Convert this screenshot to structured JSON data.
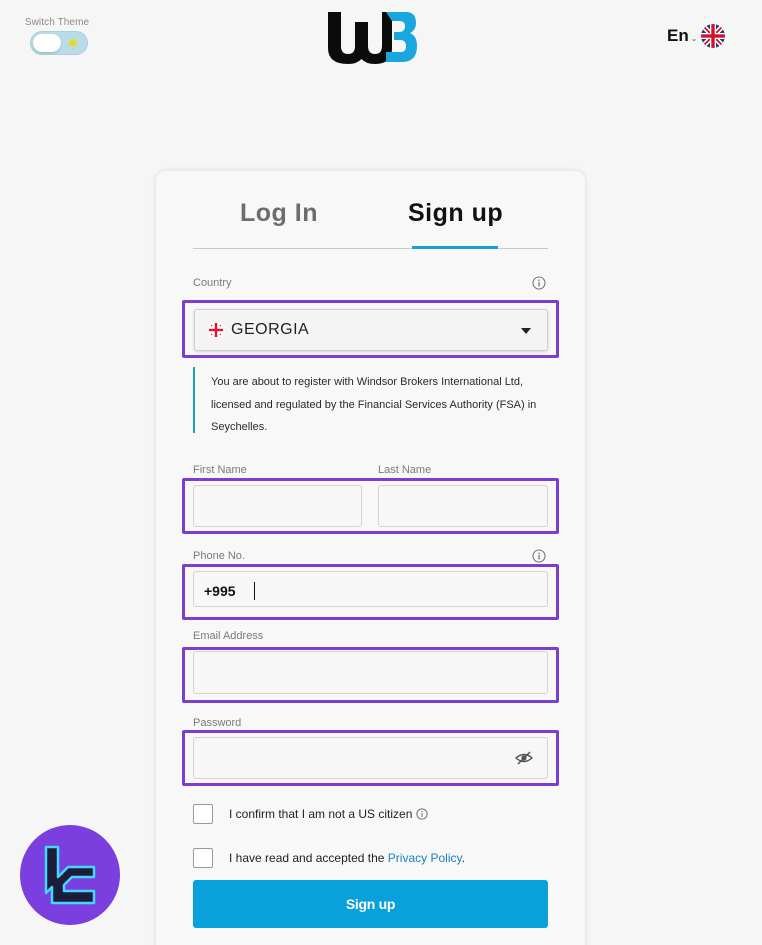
{
  "header": {
    "theme_label": "Switch Theme",
    "language_code": "En",
    "language_flag": "uk-flag-icon",
    "logo": "wb-logo"
  },
  "tabs": [
    {
      "label": "Log In",
      "active": false
    },
    {
      "label": "Sign up",
      "active": true
    }
  ],
  "form": {
    "country_label": "Country",
    "country_value": "GEORGIA",
    "notice": "You are about to register with Windsor Brokers International Ltd, licensed and regulated by the Financial Services Authority (FSA) in Seychelles.",
    "first_name_label": "First Name",
    "last_name_label": "Last Name",
    "phone_label": "Phone No.",
    "phone_prefix": "+995",
    "email_label": "Email Address",
    "password_label": "Password",
    "confirm_us": "I confirm that I am not a US citizen",
    "privacy_prefix": "I have read and accepted the ",
    "privacy_link": "Privacy Policy",
    "privacy_suffix": ".",
    "submit_label": "Sign up"
  },
  "colors": {
    "accent": "#0aa0dc",
    "highlight": "#7a3fd1",
    "badge": "#7b3fe0"
  }
}
